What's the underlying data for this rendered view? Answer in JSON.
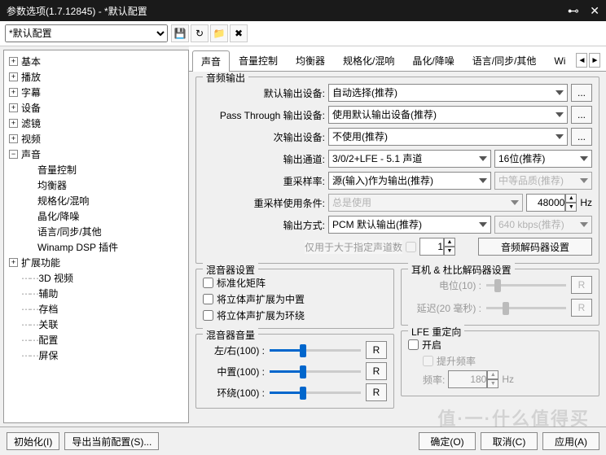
{
  "window": {
    "title": "参数选项(1.7.12845) - *默认配置"
  },
  "toolbar": {
    "profile": "*默认配置"
  },
  "tabs": {
    "items": [
      "声音",
      "音量控制",
      "均衡器",
      "规格化/混响",
      "晶化/降噪",
      "语言/同步/其他",
      "Wi"
    ],
    "active": 0
  },
  "tree": [
    {
      "label": "基本",
      "lvl": 0,
      "exp": false,
      "t": true
    },
    {
      "label": "播放",
      "lvl": 0,
      "exp": false,
      "t": true
    },
    {
      "label": "字幕",
      "lvl": 0,
      "exp": false,
      "t": true
    },
    {
      "label": "设备",
      "lvl": 0,
      "exp": false,
      "t": true
    },
    {
      "label": "滤镜",
      "lvl": 0,
      "exp": false,
      "t": true
    },
    {
      "label": "视频",
      "lvl": 0,
      "exp": false,
      "t": true
    },
    {
      "label": "声音",
      "lvl": 0,
      "exp": true,
      "t": true
    },
    {
      "label": "音量控制",
      "lvl": 1,
      "t": false
    },
    {
      "label": "均衡器",
      "lvl": 1,
      "t": false
    },
    {
      "label": "规格化/混响",
      "lvl": 1,
      "t": false
    },
    {
      "label": "晶化/降噪",
      "lvl": 1,
      "t": false
    },
    {
      "label": "语言/同步/其他",
      "lvl": 1,
      "t": false
    },
    {
      "label": "Winamp DSP 插件",
      "lvl": 1,
      "t": false
    },
    {
      "label": "扩展功能",
      "lvl": 0,
      "exp": false,
      "t": true
    },
    {
      "label": "3D 视频",
      "lvl": 0,
      "t": false,
      "dots": true
    },
    {
      "label": "辅助",
      "lvl": 0,
      "t": false,
      "dots": true
    },
    {
      "label": "存档",
      "lvl": 0,
      "t": false,
      "dots": true
    },
    {
      "label": "关联",
      "lvl": 0,
      "t": false,
      "dots": true
    },
    {
      "label": "配置",
      "lvl": 0,
      "t": false,
      "dots": true
    },
    {
      "label": "屏保",
      "lvl": 0,
      "t": false,
      "dots": true
    }
  ],
  "audio_output": {
    "legend": "音频输出",
    "default_device_label": "默认输出设备:",
    "default_device": "自动选择(推荐)",
    "passthrough_label": "Pass Through 输出设备:",
    "passthrough": "使用默认输出设备(推荐)",
    "secondary_label": "次输出设备:",
    "secondary": "不使用(推荐)",
    "channel_label": "输出通道:",
    "channel": "3/0/2+LFE - 5.1 声道",
    "bitdepth": "16位(推荐)",
    "resample_label": "重采样率:",
    "resample": "源(输入)作为输出(推荐)",
    "resample_quality": "中等品质(推荐)",
    "resample_cond_label": "重采样使用条件:",
    "resample_cond": "总是使用",
    "resample_hz": "48000",
    "hz": "Hz",
    "output_mode_label": "输出方式:",
    "output_mode": "PCM 默认输出(推荐)",
    "bitrate": "640 kbps(推荐)",
    "limit_label": "仅用于大于指定声道数",
    "limit_value": "1",
    "decoder_btn": "音频解码器设置"
  },
  "mixer": {
    "legend": "混音器设置",
    "normalize": "标准化矩阵",
    "expand_center": "将立体声扩展为中置",
    "expand_surround": "将立体声扩展为环绕",
    "volume_legend": "混音器音量",
    "lr_label": "左/右(100) :",
    "center_label": "中置(100) :",
    "surround_label": "环绕(100) :",
    "reset": "R"
  },
  "headphone": {
    "legend": "耳机 & 杜比解码器设置",
    "potential_label": "电位(10) :",
    "delay_label": "延迟(20 毫秒) :",
    "reset": "R",
    "lfe_legend": "LFE 重定向",
    "enable": "开启",
    "boost": "提升频率",
    "freq_label": "频率:",
    "freq_value": "180",
    "hz": "Hz"
  },
  "footer": {
    "init": "初始化(I)",
    "export": "导出当前配置(S)...",
    "ok": "确定(O)",
    "cancel": "取消(C)",
    "apply": "应用(A)"
  },
  "watermark": "值·一·什么值得买"
}
